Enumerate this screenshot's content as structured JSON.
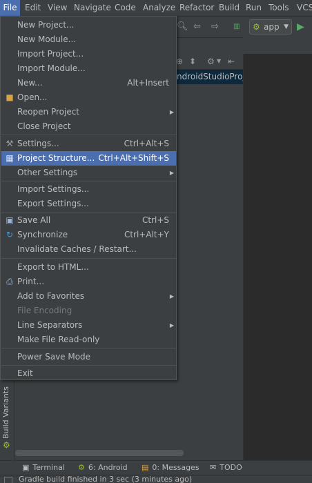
{
  "menubar": {
    "items": [
      "File",
      "Edit",
      "View",
      "Navigate",
      "Code",
      "Analyze",
      "Refactor",
      "Build",
      "Run",
      "Tools",
      "VCS"
    ]
  },
  "toolbar": {
    "run_config": "app",
    "icons": [
      "search-icon",
      "back-arrow-icon",
      "forward-arrow-icon",
      "make-icon",
      "android-icon",
      "run-icon"
    ]
  },
  "project_panel": {
    "path": "ndroidStudioProje"
  },
  "file_menu": {
    "items": [
      {
        "label": "New Project...",
        "shortcut": "",
        "submenu": false,
        "disabled": false,
        "selected": false
      },
      {
        "label": "New Module...",
        "shortcut": "",
        "submenu": false,
        "disabled": false,
        "selected": false
      },
      {
        "label": "Import Project...",
        "shortcut": "",
        "submenu": false,
        "disabled": false,
        "selected": false
      },
      {
        "label": "Import Module...",
        "shortcut": "",
        "submenu": false,
        "disabled": false,
        "selected": false
      },
      {
        "label": "New...",
        "shortcut": "Alt+Insert",
        "submenu": false,
        "disabled": false,
        "selected": false
      },
      {
        "label": "Open...",
        "shortcut": "",
        "submenu": false,
        "disabled": false,
        "selected": false,
        "icon": "folder-icon"
      },
      {
        "label": "Reopen Project",
        "shortcut": "",
        "submenu": true,
        "disabled": false,
        "selected": false
      },
      {
        "label": "Close Project",
        "shortcut": "",
        "submenu": false,
        "disabled": false,
        "selected": false
      },
      {
        "label": "Settings...",
        "shortcut": "Ctrl+Alt+S",
        "submenu": false,
        "disabled": false,
        "selected": false,
        "icon": "settings-wrench-icon"
      },
      {
        "label": "Project Structure...",
        "shortcut": "Ctrl+Alt+Shift+S",
        "submenu": false,
        "disabled": false,
        "selected": true,
        "icon": "project-structure-icon"
      },
      {
        "label": "Other Settings",
        "shortcut": "",
        "submenu": true,
        "disabled": false,
        "selected": false
      },
      {
        "label": "Import Settings...",
        "shortcut": "",
        "submenu": false,
        "disabled": false,
        "selected": false
      },
      {
        "label": "Export Settings...",
        "shortcut": "",
        "submenu": false,
        "disabled": false,
        "selected": false
      },
      {
        "label": "Save All",
        "shortcut": "Ctrl+S",
        "submenu": false,
        "disabled": false,
        "selected": false,
        "icon": "save-icon"
      },
      {
        "label": "Synchronize",
        "shortcut": "Ctrl+Alt+Y",
        "submenu": false,
        "disabled": false,
        "selected": false,
        "icon": "sync-icon"
      },
      {
        "label": "Invalidate Caches / Restart...",
        "shortcut": "",
        "submenu": false,
        "disabled": false,
        "selected": false
      },
      {
        "label": "Export to HTML...",
        "shortcut": "",
        "submenu": false,
        "disabled": false,
        "selected": false
      },
      {
        "label": "Print...",
        "shortcut": "",
        "submenu": false,
        "disabled": false,
        "selected": false,
        "icon": "print-icon"
      },
      {
        "label": "Add to Favorites",
        "shortcut": "",
        "submenu": true,
        "disabled": false,
        "selected": false
      },
      {
        "label": "File Encoding",
        "shortcut": "",
        "submenu": false,
        "disabled": true,
        "selected": false
      },
      {
        "label": "Line Separators",
        "shortcut": "",
        "submenu": true,
        "disabled": false,
        "selected": false
      },
      {
        "label": "Make File Read-only",
        "shortcut": "",
        "submenu": false,
        "disabled": false,
        "selected": false
      },
      {
        "label": "Power Save Mode",
        "shortcut": "",
        "submenu": false,
        "disabled": false,
        "selected": false
      },
      {
        "label": "Exit",
        "shortcut": "",
        "submenu": false,
        "disabled": false,
        "selected": false
      }
    ]
  },
  "left_stripe": {
    "build_variants": "Build Variants"
  },
  "bottombar": {
    "terminal": "Terminal",
    "android": "6: Android",
    "messages": "0: Messages",
    "todo": "TODO"
  },
  "status": {
    "text": "Gradle build finished in 3 sec (3 minutes ago)"
  },
  "colors": {
    "accent": "#4b6eaf",
    "background": "#3c3f41",
    "editor": "#2b2b2b",
    "android_green": "#97c024"
  }
}
